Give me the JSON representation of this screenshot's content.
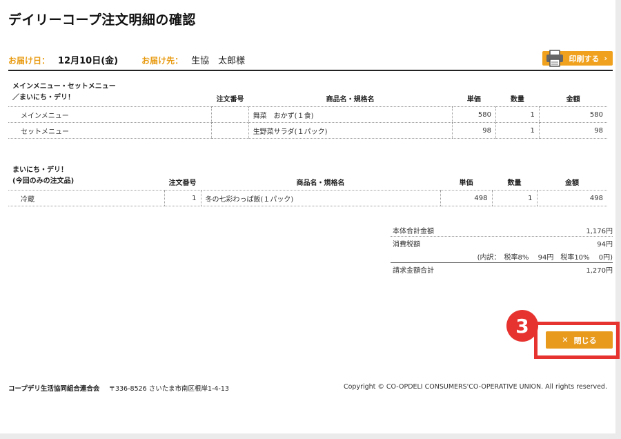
{
  "title": "デイリーコープ注文明細の確認",
  "delivery": {
    "date_label": "お届け日：",
    "date_value": "12月10日(金)",
    "to_label": "お届け先：",
    "to_value": "生協　太郎様"
  },
  "print_button": {
    "label": "印刷する",
    "icon": "printer-icon"
  },
  "section1": {
    "category_line1": "メインメニュー・セットメニュー",
    "category_line2": "／まいにち・デリ！",
    "headers": {
      "order_no": "注文番号",
      "product": "商品名・規格名",
      "unit_price": "単価",
      "qty": "数量",
      "amount": "金額"
    },
    "rows": [
      {
        "type": "メインメニュー",
        "order_no": "",
        "product": "舞菜　おかず(１食)",
        "unit_price": "580",
        "qty": "1",
        "amount": "580"
      },
      {
        "type": "セットメニュー",
        "order_no": "",
        "product": "生野菜サラダ(１パック)",
        "unit_price": "98",
        "qty": "1",
        "amount": "98"
      }
    ]
  },
  "section2": {
    "category_line1": "まいにち・デリ！",
    "category_line2": "(今回のみの注文品)",
    "headers": {
      "order_no": "注文番号",
      "product": "商品名・規格名",
      "unit_price": "単価",
      "qty": "数量",
      "amount": "金額"
    },
    "rows": [
      {
        "type": "冷蔵",
        "order_no": "1",
        "product": "冬の七彩わっぱ飯(１パック)",
        "unit_price": "498",
        "qty": "1",
        "amount": "498"
      }
    ]
  },
  "totals": {
    "subtotal_label": "本体合計金額",
    "subtotal_value": "1,176円",
    "tax_label": "消費税額",
    "tax_value": "94円",
    "tax_breakdown": "(内訳：　税率8%　 94円　税率10%　 0円)",
    "total_label": "請求金額合計",
    "total_value": "1,270円"
  },
  "annotation": {
    "number": "3",
    "color": "#e63330"
  },
  "close_button": {
    "label": "閉じる",
    "icon": "close-icon"
  },
  "footer": {
    "org": "コープデリ生活協同組合連合会",
    "address": "〒336-8526 さいたま市南区根岸1-4-13",
    "copyright": "Copyright © CO-OPDELI CONSUMERS'CO-OPERATIVE UNION. All rights reserved."
  },
  "colors": {
    "accent": "#f0a21f",
    "label": "#e89a10",
    "annotation": "#e63330"
  }
}
